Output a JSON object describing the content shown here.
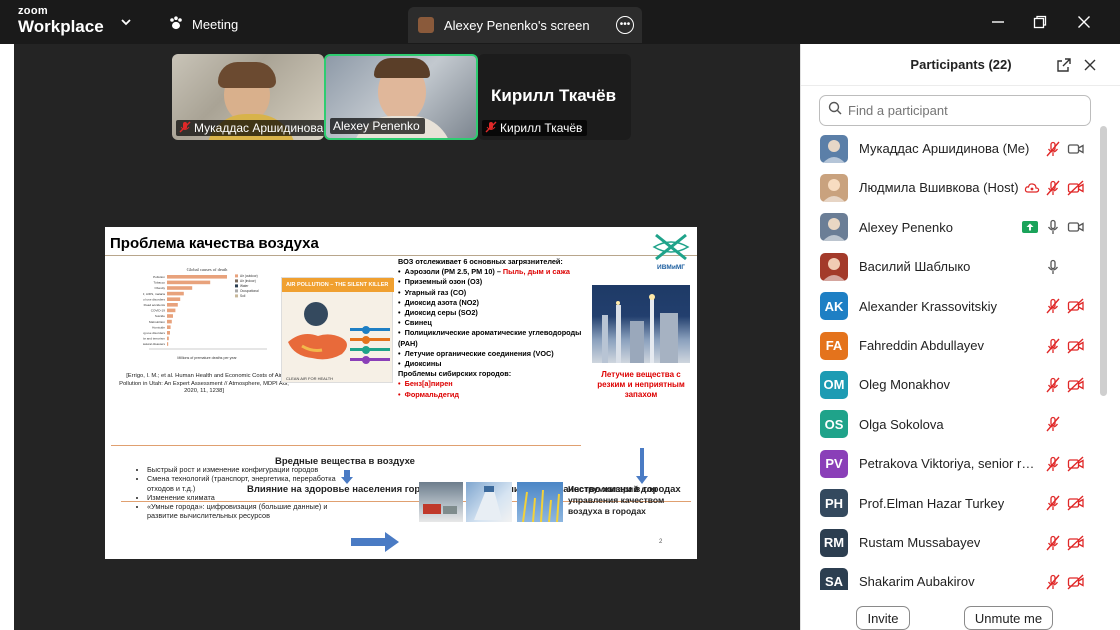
{
  "app": {
    "logo_line1": "zoom",
    "logo_line2": "Workplace"
  },
  "titlebar": {
    "meeting_label": "Meeting",
    "share_tab_label": "Alexey Penenko's screen"
  },
  "video_tiles": [
    {
      "name": "Мукаддас Аршидинова",
      "muted": true
    },
    {
      "name": "Alexey Penenko",
      "muted": false,
      "active_speaker": true
    },
    {
      "name": "Кирилл Ткачёв",
      "big_name": "Кирилл Ткачёв",
      "muted": true
    }
  ],
  "slide": {
    "title": "Проблема качества воздуха",
    "chart_title": "Global causes of death",
    "chart_rows": [
      "Pollution",
      "Tobacco",
      "Obesity",
      "FR, AIDS, malaria",
      "Alcohol use disorders",
      "Road accidents",
      "COVID-19",
      "Suicide",
      "Malnutrition",
      "Homicide",
      "Drug use disorders",
      "War and terrorism",
      "Natural disasters"
    ],
    "chart_legend": [
      "Air (outdoor)",
      "Air (indoor)",
      "Water",
      "Occupational",
      "Soil"
    ],
    "chart_xlabel": "Millions of premature deaths per year",
    "citation": "[Errigo, I. M.; et al. Human Health and Economic Costs of Air Pollution in Utah: An Expert Assessment // Atmosphere, MDPI AG, 2020, 11, 1238]",
    "poster_title": "AIR POLLUTION – THE SILENT KILLER",
    "poster_footer": "CLEAN AIR FOR HEALTH",
    "who_header": "ВОЗ отслеживает 6 основных загрязнителей:",
    "aerosols": "Аэрозоли  (PM 2.5, PM 10) – ",
    "aerosols_red": "Пыль, дым и сажа",
    "pollutants": [
      "Приземный озон (O3)",
      "Угарный газ (CO)",
      "Диоксид азота (NO2)",
      "Диоксид серы (SO2)",
      "Свинец",
      "Полициклические ароматические углеводороды (PAH)",
      "Летучие органические соединения (VOC)",
      "Диоксины"
    ],
    "siberian_header": "Проблемы сибирских городов:",
    "siberian": [
      "Бенз[а]пирен",
      "Формальдегид"
    ],
    "logo_text": "ИВМиМГ",
    "volatile": "Летучие вещества с резким и неприятным запахом",
    "harmful": "Вредные вещества в воздухе",
    "health": "Влияние на здоровье населения городов",
    "quality_of_life": "Влияние на качество жизни в городах",
    "bullets": [
      "Быстрый рост и изменение конфигурации городов",
      "Смена технологий (транспорт, энергетика, переработка отходов и т.д.)",
      "Изменение климата",
      "«Умные города»: цифровизация (большие данные) и развитие вычислительных ресурсов"
    ],
    "tools": "Инструментарий для управления качеством воздуха в городах",
    "page": "2"
  },
  "participants": {
    "title": "Participants (22)",
    "search_placeholder": "Find a participant",
    "list": [
      {
        "name": "Мукаддас Аршидинова (Me)",
        "avatar": "photo",
        "color": "#5b7fa8",
        "mic": "muted",
        "video": "on",
        "extra": ""
      },
      {
        "name": "Людмила Вшивкова (Host)",
        "avatar": "photo",
        "color": "#c9a27e",
        "mic": "muted",
        "video": "off",
        "extra": "cloud"
      },
      {
        "name": "Alexey Penenko",
        "avatar": "photo",
        "color": "#6b7e96",
        "mic": "on",
        "video": "on",
        "extra": "share"
      },
      {
        "name": "Василий Шаблыко",
        "avatar": "photo",
        "color": "#a33a2a",
        "mic": "on",
        "video": "none",
        "extra": ""
      },
      {
        "name": "Alexander Krassovitskiy",
        "avatar": "AK",
        "color": "#1e7fc4",
        "mic": "muted",
        "video": "off",
        "extra": ""
      },
      {
        "name": "Fahreddin Abdullayev",
        "avatar": "FA",
        "color": "#e4731c",
        "mic": "muted",
        "video": "off",
        "extra": ""
      },
      {
        "name": "Oleg Monakhov",
        "avatar": "OM",
        "color": "#1d9bb3",
        "mic": "muted",
        "video": "off",
        "extra": ""
      },
      {
        "name": "Olga Sokolova",
        "avatar": "OS",
        "color": "#1fa38a",
        "mic": "muted",
        "video": "none",
        "extra": ""
      },
      {
        "name": "Petrakova Viktoriya, senior rese...",
        "avatar": "PV",
        "color": "#8a3fb8",
        "mic": "muted",
        "video": "off",
        "extra": ""
      },
      {
        "name": "Prof.Elman Hazar Turkey",
        "avatar": "PH",
        "color": "#34495e",
        "mic": "muted",
        "video": "off",
        "extra": ""
      },
      {
        "name": "Rustam Mussabayev",
        "avatar": "RM",
        "color": "#2c3e50",
        "mic": "muted",
        "video": "off",
        "extra": ""
      },
      {
        "name": "Shakarim Aubakirov",
        "avatar": "SA",
        "color": "#2c3e50",
        "mic": "muted",
        "video": "off",
        "extra": ""
      }
    ],
    "invite_label": "Invite",
    "unmute_label": "Unmute me"
  },
  "colors": {
    "muted_red": "#e02828",
    "active_green": "#2ecc71",
    "share_green": "#1aa35a"
  }
}
